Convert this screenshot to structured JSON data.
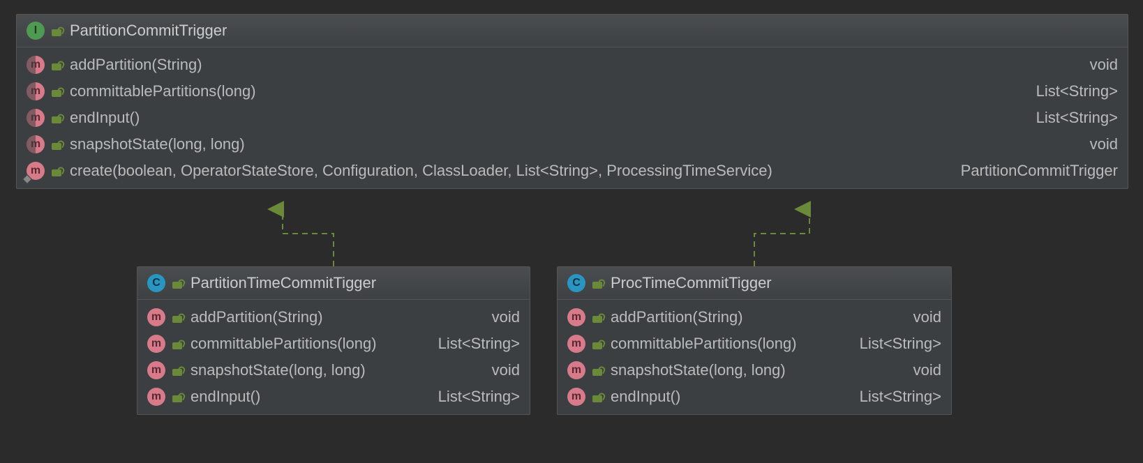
{
  "colors": {
    "background": "#2b2b2b",
    "panel": "#3c3f41",
    "border": "#555555",
    "text": "#bbbbbb",
    "interfaceIcon": "#4e9a52",
    "classIcon": "#2996c2",
    "methodIcon": "#d77b8a",
    "lockIcon": "#6a8a3a",
    "arrow": "#6a8a3a"
  },
  "parent": {
    "kind": "Interface",
    "name": "PartitionCommitTrigger",
    "members": [
      {
        "abstract": true,
        "signature": "addPartition(String)",
        "returns": "void"
      },
      {
        "abstract": true,
        "signature": "committablePartitions(long)",
        "returns": "List<String>"
      },
      {
        "abstract": true,
        "signature": "endInput()",
        "returns": "List<String>"
      },
      {
        "abstract": true,
        "signature": "snapshotState(long, long)",
        "returns": "void"
      },
      {
        "abstract": false,
        "static": true,
        "signature": "create(boolean, OperatorStateStore, Configuration, ClassLoader, List<String>, ProcessingTimeService)",
        "returns": "PartitionCommitTrigger"
      }
    ]
  },
  "childA": {
    "kind": "Class",
    "name": "PartitionTimeCommitTigger",
    "members": [
      {
        "signature": "addPartition(String)",
        "returns": "void"
      },
      {
        "signature": "committablePartitions(long)",
        "returns": "List<String>"
      },
      {
        "signature": "snapshotState(long, long)",
        "returns": "void"
      },
      {
        "signature": "endInput()",
        "returns": "List<String>"
      }
    ]
  },
  "childB": {
    "kind": "Class",
    "name": "ProcTimeCommitTigger",
    "members": [
      {
        "signature": "addPartition(String)",
        "returns": "void"
      },
      {
        "signature": "committablePartitions(long)",
        "returns": "List<String>"
      },
      {
        "signature": "snapshotState(long, long)",
        "returns": "void"
      },
      {
        "signature": "endInput()",
        "returns": "List<String>"
      }
    ]
  },
  "relations": [
    {
      "from": "childA",
      "to": "parent",
      "type": "implements"
    },
    {
      "from": "childB",
      "to": "parent",
      "type": "implements"
    }
  ],
  "iconLetters": {
    "interface": "I",
    "class": "C",
    "method": "m"
  }
}
